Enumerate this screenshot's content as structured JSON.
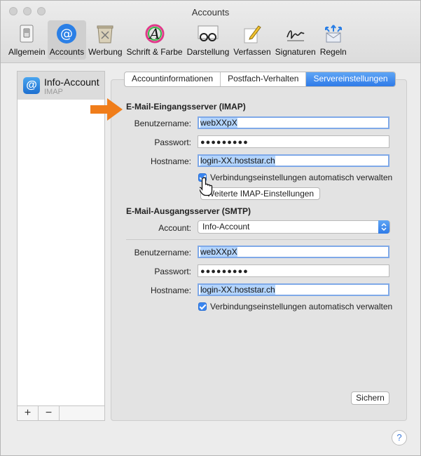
{
  "window": {
    "title": "Accounts"
  },
  "toolbar": {
    "items": [
      {
        "label": "Allgemein",
        "icon": "switch-icon"
      },
      {
        "label": "Accounts",
        "icon": "at-icon"
      },
      {
        "label": "Werbung",
        "icon": "junk-mail-icon"
      },
      {
        "label": "Schrift & Farbe",
        "icon": "fonts-colors-icon"
      },
      {
        "label": "Darstellung",
        "icon": "viewing-glasses-icon"
      },
      {
        "label": "Verfassen",
        "icon": "pencil-icon"
      },
      {
        "label": "Signaturen",
        "icon": "signature-icon"
      },
      {
        "label": "Regeln",
        "icon": "rules-icon"
      }
    ],
    "active": "Accounts"
  },
  "sidebar": {
    "account_name": "Info-Account",
    "account_type": "IMAP",
    "add_label": "+",
    "remove_label": "−"
  },
  "tabs": {
    "items": [
      "Accountinformationen",
      "Postfach-Verhalten",
      "Servereinstellungen"
    ],
    "selected": "Servereinstellungen"
  },
  "incoming": {
    "title": "E-Mail-Eingangsserver (IMAP)",
    "username_label": "Benutzername:",
    "username": "webXXpX",
    "password_label": "Passwort:",
    "password": "●●●●●●●●●",
    "hostname_label": "Hostname:",
    "hostname": "login-XX.hoststar.ch",
    "auto_label": "Verbindungseinstellungen automatisch verwalten",
    "auto_checked": true,
    "advanced_button": "Weiterte IMAP-Einstellungen"
  },
  "outgoing": {
    "title": "E-Mail-Ausgangsserver (SMTP)",
    "account_label": "Account:",
    "account_value": "Info-Account",
    "username_label": "Benutzername:",
    "username": "webXXpX",
    "password_label": "Passwort:",
    "password": "●●●●●●●●●",
    "hostname_label": "Hostname:",
    "hostname": "login-XX.hoststar.ch",
    "auto_label": "Verbindungseinstellungen automatisch verwalten",
    "auto_checked": true
  },
  "save_button": "Sichern",
  "help_button": "?",
  "colors": {
    "accent": "#2f7be8",
    "arrow": "#f07d1a",
    "selection": "#b3d4fc"
  }
}
